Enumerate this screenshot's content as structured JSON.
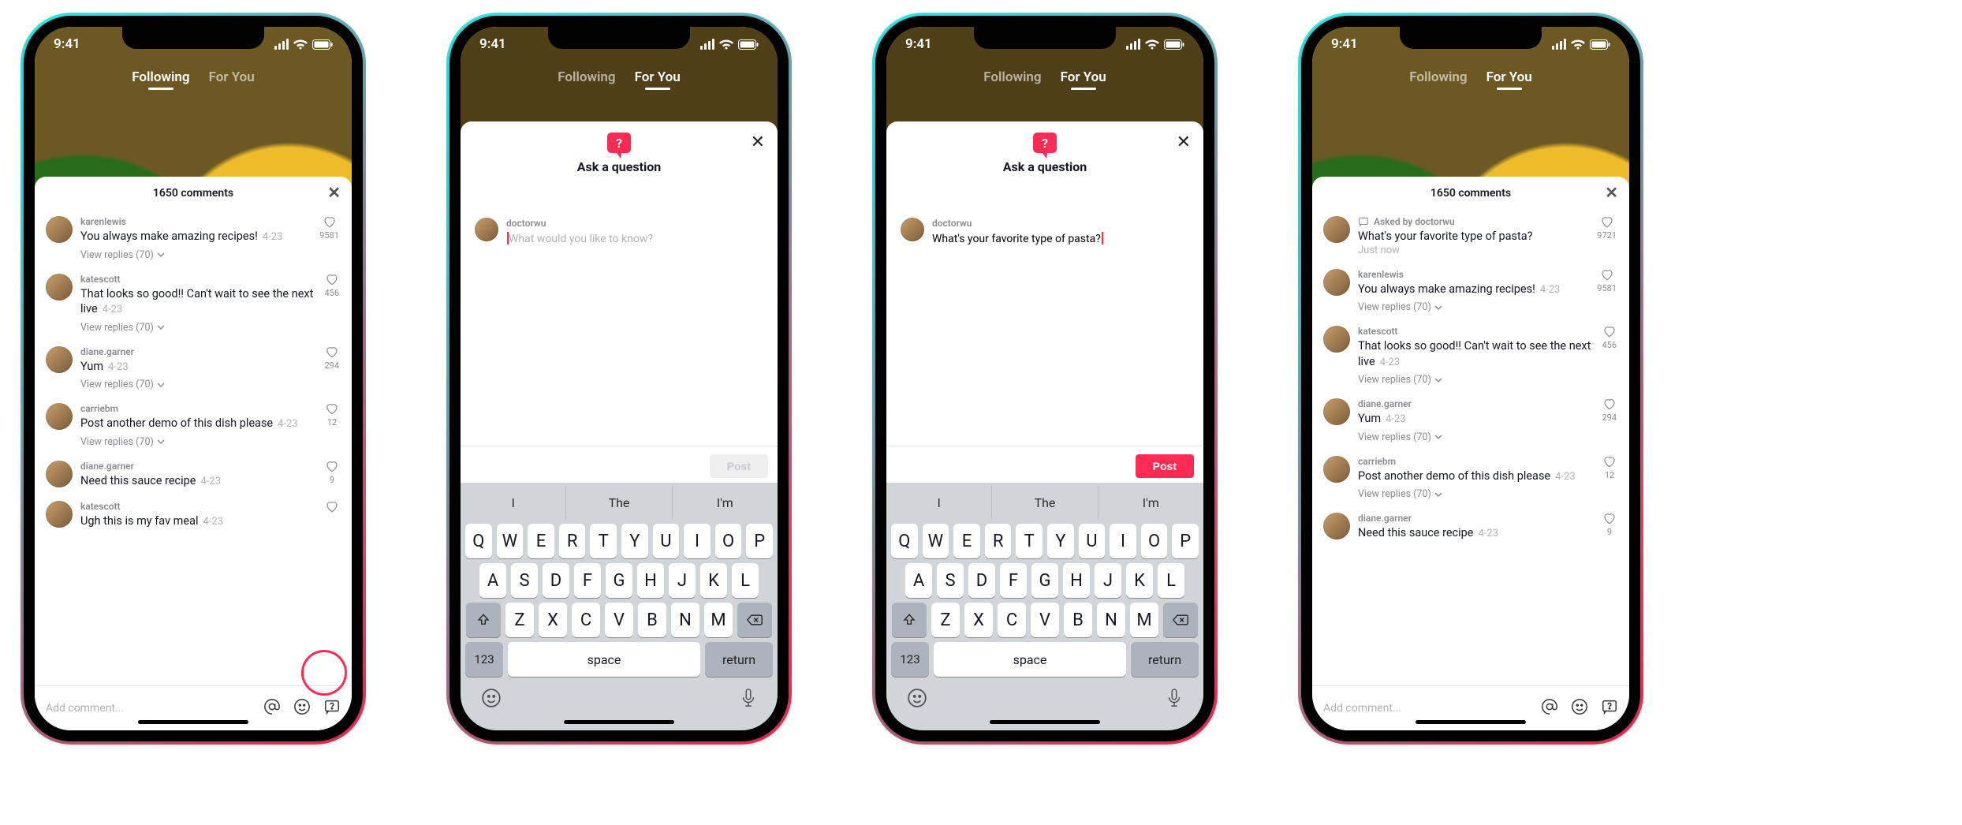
{
  "status": {
    "time": "9:41"
  },
  "tabs": {
    "following": "Following",
    "for_you": "For You"
  },
  "comments_header": {
    "count_label": "1650 comments"
  },
  "comments": [
    {
      "user": "karenlewis",
      "text": "You always make amazing recipes!",
      "date": "4-23",
      "likes": "9581",
      "replies": "View replies (70)"
    },
    {
      "user": "katescott",
      "text": "That looks so good!! Can't wait to see the next live",
      "date": "4-23",
      "likes": "456",
      "replies": "View replies (70)"
    },
    {
      "user": "diane.garner",
      "text": "Yum",
      "date": "4-23",
      "likes": "294",
      "replies": "View replies (70)"
    },
    {
      "user": "carriebm",
      "text": "Post another demo of this dish please",
      "date": "4-23",
      "likes": "12",
      "replies": "View replies (70)"
    },
    {
      "user": "diane.garner",
      "text": "Need this sauce recipe",
      "date": "4-23",
      "likes": "9",
      "replies": ""
    },
    {
      "user": "katescott",
      "text": "Ugh this is my fav meal",
      "date": "4-23",
      "likes": "",
      "replies": ""
    }
  ],
  "question_comment": {
    "asked_by_label": "Asked by doctorwu",
    "text": "What's your favorite type of pasta?",
    "time": "Just now",
    "likes": "9721"
  },
  "comment_input": {
    "placeholder": "Add comment..."
  },
  "ask_sheet": {
    "title": "Ask a question",
    "user": "doctorwu",
    "placeholder": "What would you like to know?",
    "typed": "What's your favorite type of pasta?",
    "post_label": "Post"
  },
  "keyboard": {
    "suggestions": [
      "I",
      "The",
      "I'm"
    ],
    "row1": [
      "Q",
      "W",
      "E",
      "R",
      "T",
      "Y",
      "U",
      "I",
      "O",
      "P"
    ],
    "row2": [
      "A",
      "S",
      "D",
      "F",
      "G",
      "H",
      "J",
      "K",
      "L"
    ],
    "row3": [
      "Z",
      "X",
      "C",
      "V",
      "B",
      "N",
      "M"
    ],
    "num": "123",
    "space": "space",
    "ret": "return"
  }
}
